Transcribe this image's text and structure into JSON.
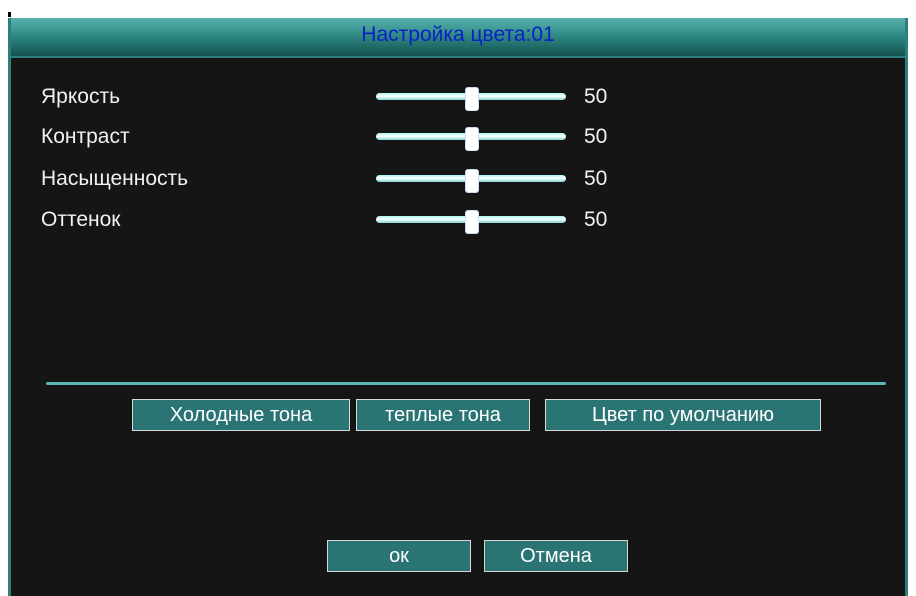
{
  "dialog": {
    "title": "Настройка цвета:01"
  },
  "sliders": [
    {
      "label": "Яркость",
      "value": "50",
      "level": 50
    },
    {
      "label": "Контраст",
      "value": "50",
      "level": 50
    },
    {
      "label": "Насыщенность",
      "value": "50",
      "level": 50
    },
    {
      "label": "Оттенок",
      "value": "50",
      "level": 50
    }
  ],
  "presets": {
    "cold": "Холодные тона",
    "warm": "теплые тона",
    "default": "Цвет по умолчанию"
  },
  "actions": {
    "ok": "ок",
    "cancel": "Отмена"
  },
  "colors": {
    "title_text": "#0c1fc7",
    "accent": "#2c7f7c",
    "button_bg": "#2a7574",
    "background": "#151515"
  }
}
